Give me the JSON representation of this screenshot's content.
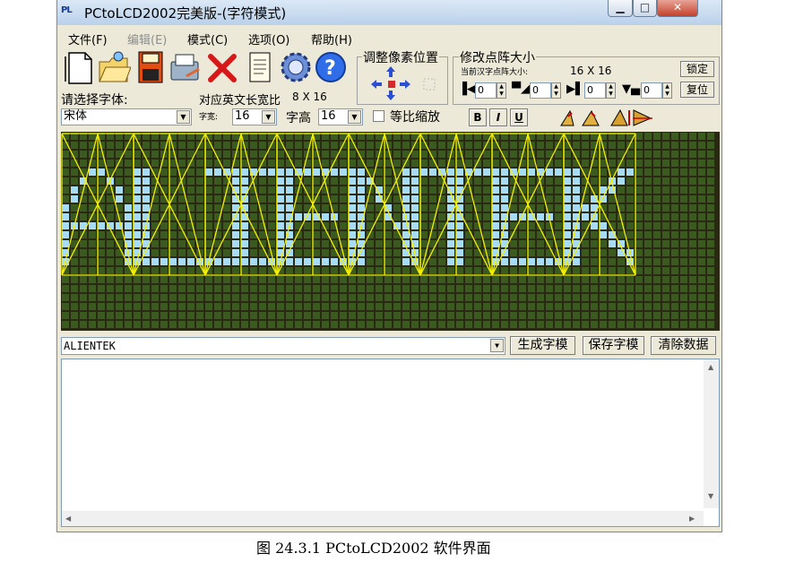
{
  "window": {
    "app_icon_text": "PL",
    "title": "PCtoLCD2002完美版-(字符模式)",
    "minimize_glyph": "▁",
    "maximize_glyph": "□",
    "close_glyph": "✕"
  },
  "menu": {
    "file": "文件(F)",
    "edit": "编辑(E)",
    "mode": "模式(C)",
    "options": "选项(O)",
    "help": "帮助(H)"
  },
  "toolbar": {
    "icons": [
      "new-file-icon",
      "open-folder-icon",
      "save-disk-icon",
      "save-as-icon",
      "delete-icon",
      "document-icon",
      "settings-gear-icon",
      "help-icon"
    ]
  },
  "pixel_group": {
    "title": "调整像素位置"
  },
  "matrix_group": {
    "title": "修改点阵大小",
    "current_label": "当前汉字点阵大小:",
    "current_value": "16 X 16",
    "lock_label": "锁定",
    "reset_label": "复位",
    "spin_values": [
      "0",
      "0",
      "0",
      "0"
    ]
  },
  "font": {
    "select_label": "请选择字体:",
    "font_value": "宋体",
    "english_ratio_label": "对应英文长宽比",
    "english_ratio_value": "8 X 16",
    "width_label": "字宽:",
    "width_value": "16",
    "height_label": "字高",
    "height_value": "16",
    "proportional_label": "等比缩放",
    "bold_label": "B",
    "italic_label": "I",
    "underline_label": "U"
  },
  "input": {
    "text": "ALIENTEK"
  },
  "buttons": {
    "generate": "生成字模",
    "save": "保存字模",
    "clear": "清除数据"
  },
  "scroll": {
    "up": "▲",
    "down": "▼",
    "left": "◀",
    "right": "▶"
  },
  "colors": {
    "grid_bg": "#2a2a14",
    "pixel_off": "#3b5a1f",
    "pixel_on": "#a8dcf4",
    "guide": "#f5f000"
  },
  "caption": "图 24.3.1 PCtoLCD2002 软件界面"
}
